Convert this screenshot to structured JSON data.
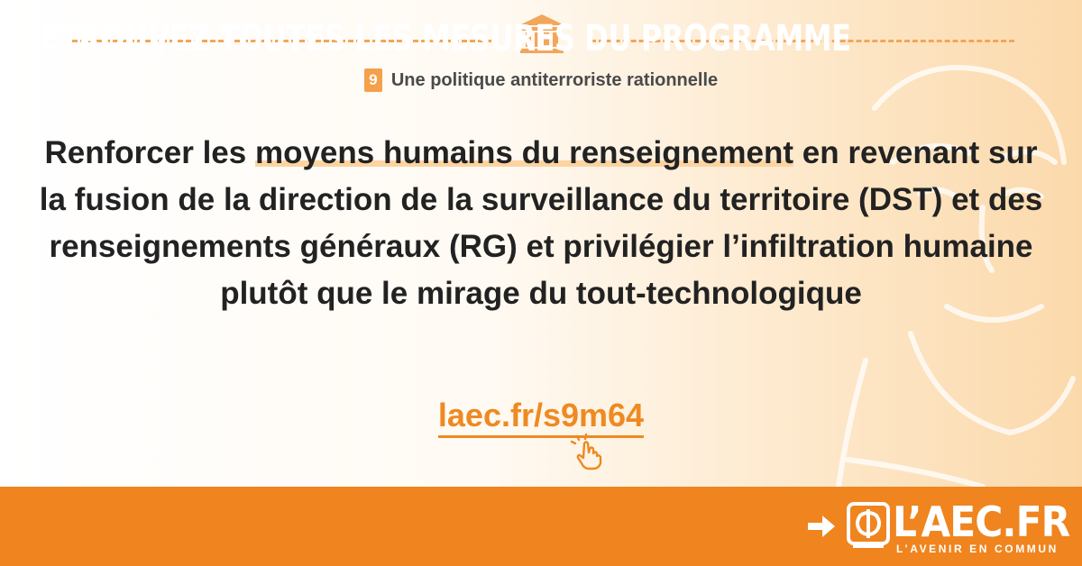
{
  "chapter": {
    "number": "9",
    "title": "Une politique antiterroriste rationnelle"
  },
  "measure": {
    "text_before": "Renforcer les ",
    "highlight": "moyens humains du renseignement",
    "text_after": " en revenant sur la fusion de la direction de la surveillance du territoire (DST) et des renseignements généraux (RG) et privilégier l’infiltration humaine plutôt que le mirage du tout-technologique"
  },
  "link": {
    "label": "laec.fr/s9m64"
  },
  "banner": {
    "cta": "RETROUVEZ TOUTES LES MESURES DU PROGRAMME",
    "logo_name": "L’AEC.FR",
    "logo_tagline": "L’AVENIR EN COMMUN"
  },
  "colors": {
    "accent": "#f0841e",
    "text": "#222222",
    "highlight": "#fbd4a2",
    "dash": "#f2a65a"
  },
  "icons": {
    "header": "temple-icon",
    "cursor": "pointer-hand-icon",
    "arrow": "arrow-right-icon",
    "logo": "phi-logo-icon"
  }
}
